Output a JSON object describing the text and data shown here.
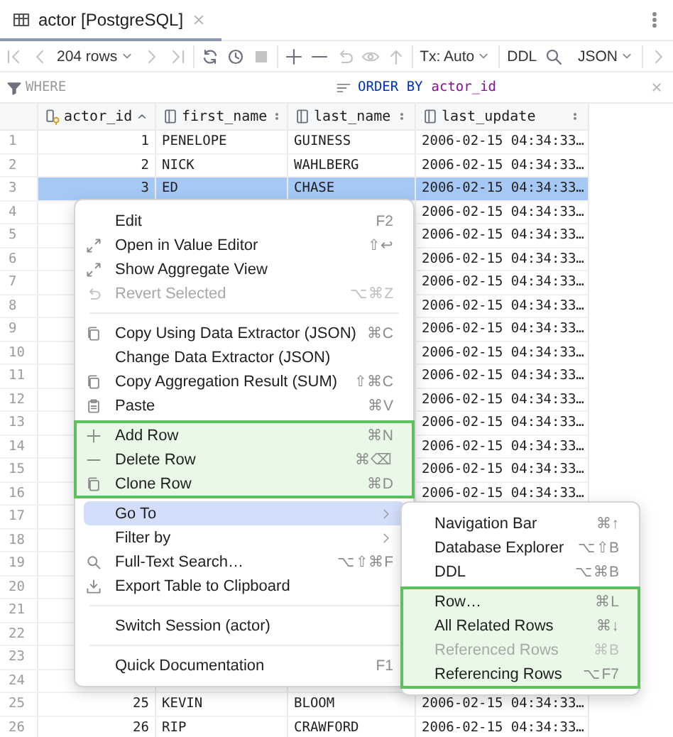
{
  "tabs": [
    {
      "label": "actor [PostgreSQL]",
      "selected": true
    }
  ],
  "toolbar": {
    "row_count": "204 rows",
    "transaction": "Tx: Auto",
    "ddl": "DDL",
    "format": "JSON"
  },
  "filter_bar": {
    "where": {
      "placeholder": "WHERE"
    },
    "order_by": {
      "keyword": "ORDER BY",
      "column": "actor_id"
    }
  },
  "table": {
    "columns": [
      {
        "name": "actor_id",
        "primary_key": true,
        "sorted": true
      },
      {
        "name": "first_name",
        "primary_key": false,
        "sorted": false
      },
      {
        "name": "last_name",
        "primary_key": false,
        "sorted": false
      },
      {
        "name": "last_update",
        "primary_key": false,
        "sorted": false
      }
    ],
    "rows": [
      {
        "number": "1",
        "selected": false,
        "actor_id": "1",
        "first_name": "PENELOPE",
        "last_name": "GUINESS",
        "last_update": "2006-02-15 04:34:33…"
      },
      {
        "number": "2",
        "selected": false,
        "actor_id": "2",
        "first_name": "NICK",
        "last_name": "WAHLBERG",
        "last_update": "2006-02-15 04:34:33…"
      },
      {
        "number": "3",
        "selected": true,
        "actor_id": "3",
        "first_name": "ED",
        "last_name": "CHASE",
        "last_update": "2006-02-15 04:34:33…"
      },
      {
        "number": "4",
        "selected": false,
        "last_update": "2006-02-15 04:34:33…"
      },
      {
        "number": "5",
        "selected": false,
        "last_update": "2006-02-15 04:34:33…"
      },
      {
        "number": "6",
        "selected": false,
        "last_update": "2006-02-15 04:34:33…"
      },
      {
        "number": "7",
        "selected": false,
        "last_update": "2006-02-15 04:34:33…"
      },
      {
        "number": "8",
        "selected": false,
        "last_update": "2006-02-15 04:34:33…"
      },
      {
        "number": "9",
        "selected": false,
        "last_update": "2006-02-15 04:34:33…"
      },
      {
        "number": "10",
        "selected": false,
        "last_update": "2006-02-15 04:34:33…"
      },
      {
        "number": "11",
        "selected": false,
        "last_update": "2006-02-15 04:34:33…"
      },
      {
        "number": "12",
        "selected": false,
        "last_update": "2006-02-15 04:34:33…"
      },
      {
        "number": "13",
        "selected": false,
        "last_update": "2006-02-15 04:34:33…"
      },
      {
        "number": "14",
        "selected": false,
        "last_update": "2006-02-15 04:34:33…"
      },
      {
        "number": "15",
        "selected": false,
        "last_update": "2006-02-15 04:34:33…"
      },
      {
        "number": "16",
        "selected": false,
        "last_update": "2006-02-15 04:34:33…"
      },
      {
        "number": "17",
        "selected": false
      },
      {
        "number": "18",
        "selected": false
      },
      {
        "number": "19",
        "selected": false
      },
      {
        "number": "20",
        "selected": false
      },
      {
        "number": "21",
        "selected": false
      },
      {
        "number": "22",
        "selected": false
      },
      {
        "number": "23",
        "selected": false
      },
      {
        "number": "24",
        "selected": false
      },
      {
        "number": "25",
        "selected": false,
        "actor_id": "25",
        "first_name": "KEVIN",
        "last_name": "BLOOM",
        "last_update": "2006-02-15 04:34:33…"
      },
      {
        "number": "26",
        "selected": false,
        "actor_id": "26",
        "first_name": "RIP",
        "last_name": "CRAWFORD",
        "last_update": "2006-02-15 04:34:33…"
      }
    ]
  },
  "context_menu": {
    "sections": [
      {
        "highlighted": false,
        "items": [
          {
            "kind": "plain",
            "label": "Edit",
            "shortcut": "F2",
            "disabled": false,
            "selected": false,
            "submenu": false
          },
          {
            "kind": "expand",
            "label": "Open in Value Editor",
            "shortcut": "⇧↩",
            "disabled": false,
            "selected": false,
            "submenu": false
          },
          {
            "kind": "expand",
            "label": "Show Aggregate View",
            "disabled": false,
            "selected": false,
            "submenu": false
          },
          {
            "kind": "undo",
            "label": "Revert Selected",
            "shortcut": "⌥⌘Z",
            "disabled": true,
            "selected": false,
            "submenu": false
          }
        ]
      },
      {
        "highlighted": false,
        "items": [
          {
            "kind": "copy",
            "label": "Copy Using Data Extractor (JSON)",
            "shortcut": "⌘C",
            "disabled": false,
            "selected": false,
            "submenu": false
          },
          {
            "kind": "plain",
            "label": "Change Data Extractor (JSON)",
            "disabled": false,
            "selected": false,
            "submenu": false
          },
          {
            "kind": "copy",
            "label": "Copy Aggregation Result (SUM)",
            "shortcut": "⇧⌘C",
            "disabled": false,
            "selected": false,
            "submenu": false
          },
          {
            "kind": "paste",
            "label": "Paste",
            "shortcut": "⌘V",
            "disabled": false,
            "selected": false,
            "submenu": false
          }
        ]
      },
      {
        "highlighted": true,
        "items": [
          {
            "kind": "add",
            "label": "Add Row",
            "shortcut": "⌘N",
            "disabled": false,
            "selected": false,
            "submenu": false
          },
          {
            "kind": "remove",
            "label": "Delete Row",
            "shortcut": "⌘⌫",
            "disabled": false,
            "selected": false,
            "submenu": false
          },
          {
            "kind": "copy",
            "label": "Clone Row",
            "shortcut": "⌘D",
            "disabled": false,
            "selected": false,
            "submenu": false
          }
        ]
      },
      {
        "highlighted": false,
        "items": [
          {
            "kind": "plain",
            "label": "Go To",
            "disabled": false,
            "selected": true,
            "submenu": true
          },
          {
            "kind": "plain",
            "label": "Filter by",
            "disabled": false,
            "selected": false,
            "submenu": true
          },
          {
            "kind": "search",
            "label": "Full-Text Search…",
            "shortcut": "⌥⇧⌘F",
            "disabled": false,
            "selected": false,
            "submenu": false
          },
          {
            "kind": "export",
            "label": "Export Table to Clipboard",
            "disabled": false,
            "selected": false,
            "submenu": false
          }
        ]
      },
      {
        "highlighted": false,
        "items": [
          {
            "kind": "plain",
            "label": "Switch Session (actor)",
            "disabled": false,
            "selected": false,
            "submenu": false
          }
        ]
      },
      {
        "highlighted": false,
        "items": [
          {
            "kind": "plain",
            "label": "Quick Documentation",
            "shortcut": "F1",
            "disabled": false,
            "selected": false,
            "submenu": false
          }
        ]
      }
    ]
  },
  "submenu": {
    "sections": [
      {
        "highlighted": false,
        "items": [
          {
            "label": "Navigation Bar",
            "shortcut": "⌘↑",
            "disabled": false,
            "selected": false,
            "submenu": false
          },
          {
            "label": "Database Explorer",
            "shortcut": "⌥⇧B",
            "disabled": false,
            "selected": false,
            "submenu": false
          },
          {
            "label": "DDL",
            "shortcut": "⌥⌘B",
            "disabled": false,
            "selected": false,
            "submenu": false
          }
        ]
      },
      {
        "highlighted": true,
        "items": [
          {
            "label": "Row…",
            "shortcut": "⌘L",
            "disabled": false,
            "selected": false,
            "submenu": false
          },
          {
            "label": "All Related Rows",
            "shortcut": "⌘↓",
            "disabled": false,
            "selected": false,
            "submenu": false
          },
          {
            "label": "Referenced Rows",
            "shortcut": "⌘B",
            "disabled": true,
            "selected": false,
            "submenu": false
          },
          {
            "label": "Referencing Rows",
            "shortcut": "⌥F7",
            "disabled": false,
            "selected": false,
            "submenu": false
          }
        ]
      }
    ]
  }
}
